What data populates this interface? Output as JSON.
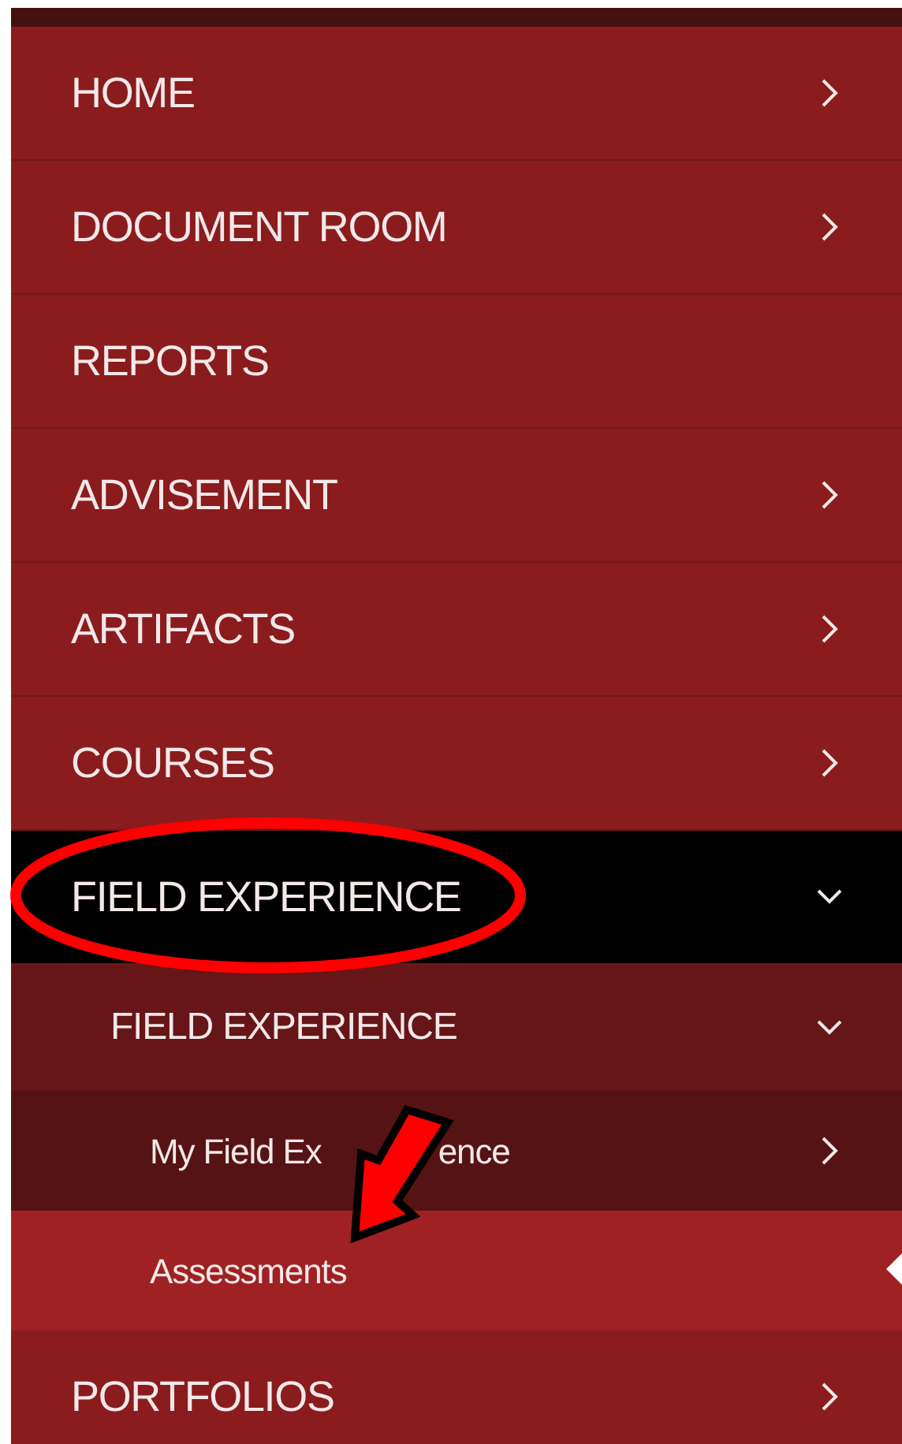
{
  "menu": {
    "items": [
      {
        "label": "HOME",
        "expanded": false,
        "selected": false
      },
      {
        "label": "DOCUMENT ROOM",
        "expanded": false,
        "selected": false
      },
      {
        "label": "REPORTS",
        "selected": false
      },
      {
        "label": "ADVISEMENT",
        "expanded": false,
        "selected": false
      },
      {
        "label": "ARTIFACTS",
        "expanded": false,
        "selected": false
      },
      {
        "label": "COURSES",
        "expanded": false,
        "selected": false
      },
      {
        "label": "FIELD EXPERIENCE",
        "expanded": true,
        "selected": false,
        "children": [
          {
            "label": "FIELD EXPERIENCE",
            "expanded": true,
            "selected": false,
            "children": [
              {
                "label": "My Field Ex",
                "label_after_arrow": "ence",
                "expanded": false,
                "selected": false
              },
              {
                "label": "Assessments",
                "selected": true
              }
            ]
          }
        ]
      },
      {
        "label": "PORTFOLIOS",
        "expanded": false,
        "selected": false
      }
    ]
  }
}
